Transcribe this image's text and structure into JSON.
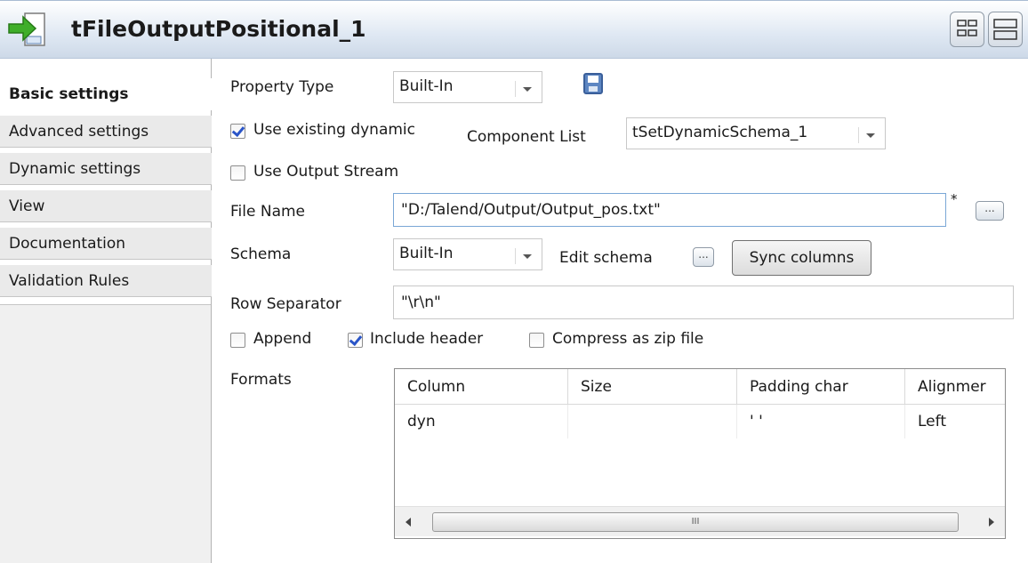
{
  "header": {
    "title": "tFileOutputPositional_1",
    "icon": "file-output-arrow-icon",
    "view_buttons": [
      "grid-view-icon",
      "list-view-icon"
    ]
  },
  "sidebar": {
    "items": [
      {
        "label": "Basic settings",
        "active": true
      },
      {
        "label": "Advanced settings"
      },
      {
        "label": "Dynamic settings"
      },
      {
        "label": "View"
      },
      {
        "label": "Documentation"
      },
      {
        "label": "Validation Rules"
      }
    ]
  },
  "form": {
    "property_type_label": "Property Type",
    "property_type_value": "Built-In",
    "use_existing_dynamic_label": "Use existing dynamic",
    "use_existing_dynamic_checked": true,
    "component_list_label": "Component List",
    "component_list_value": "tSetDynamicSchema_1",
    "use_output_stream_label": "Use Output Stream",
    "use_output_stream_checked": false,
    "file_name_label": "File Name",
    "file_name_value": "\"D:/Talend/Output/Output_pos.txt\"",
    "file_name_required_marker": "*",
    "browse_button_label": "...",
    "schema_label": "Schema",
    "schema_value": "Built-In",
    "edit_schema_label": "Edit schema",
    "edit_schema_button_label": "...",
    "sync_columns_label": "Sync columns",
    "row_separator_label": "Row Separator",
    "row_separator_value": "\"\\r\\n\"",
    "append_label": "Append",
    "append_checked": false,
    "include_header_label": "Include header",
    "include_header_checked": true,
    "compress_label": "Compress as zip file",
    "compress_checked": false,
    "formats_label": "Formats"
  },
  "formats_table": {
    "columns": [
      "Column",
      "Size",
      "Padding char",
      "Alignmer"
    ],
    "rows": [
      [
        "dyn",
        "",
        "' '",
        "Left"
      ]
    ],
    "scroll_thumb_grip": "III"
  }
}
